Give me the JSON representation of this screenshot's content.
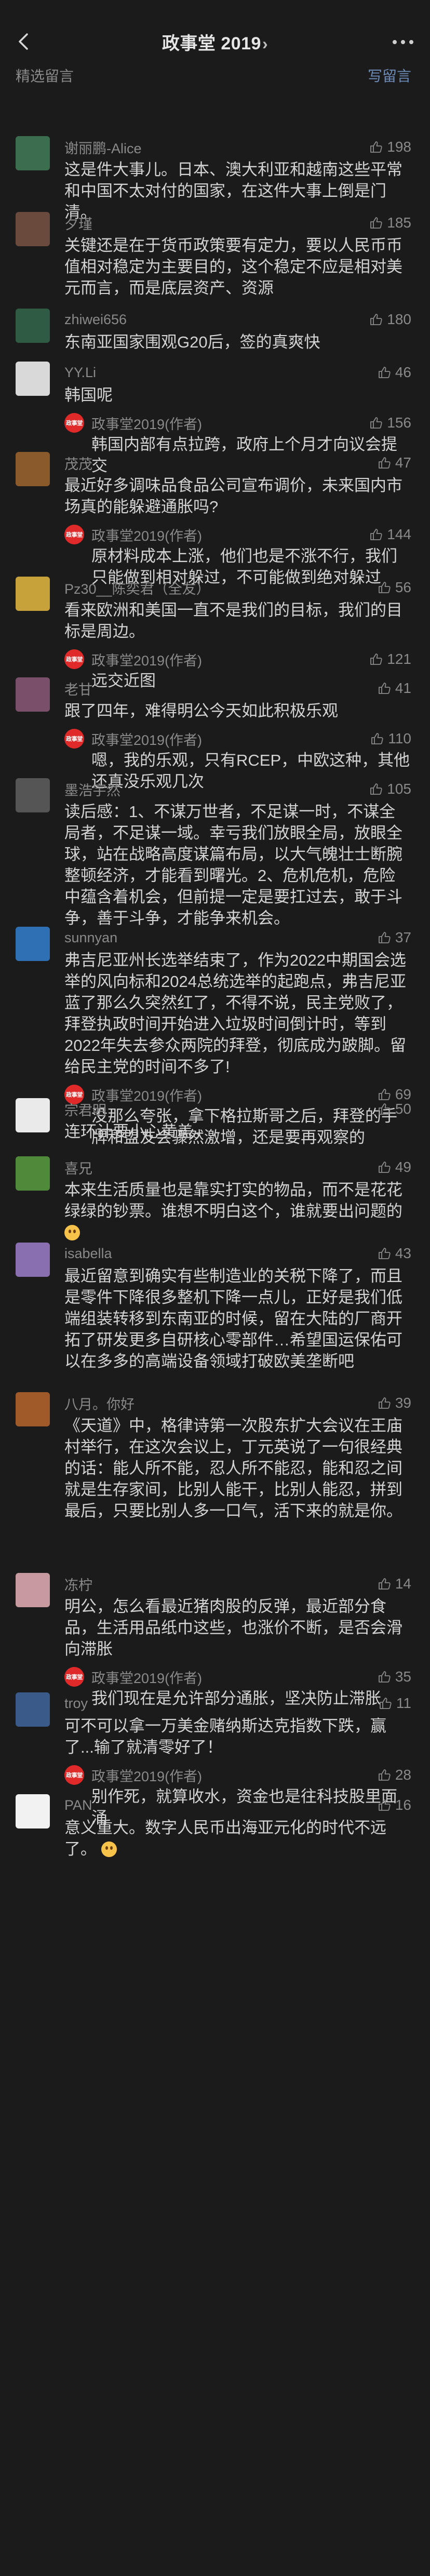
{
  "nav": {
    "title": "政事堂 2019",
    "chevron": "›"
  },
  "section": {
    "title": "精选留言",
    "action": "写留言"
  },
  "author_reply_name": "政事堂2019(作者)",
  "author_avatar_text": "政事堂",
  "comments": [
    {
      "name": "谢丽鹏-Alice",
      "likes": "198",
      "avatar": "#3b6d4f",
      "text": "这是件大事儿。日本、澳大利亚和越南这些平常和中国不太对付的国家，在这件大事上倒是门清。"
    },
    {
      "name": "夕瑾",
      "likes": "185",
      "avatar": "#6a4a3c",
      "text": "关键还是在于货币政策要有定力，要以人民币币值相对稳定为主要目的，这个稳定不应是相对美元而言，而是底层资产、资源"
    },
    {
      "name": "zhiwei656",
      "likes": "180",
      "avatar": "#2f5a44",
      "text": "东南亚国家围观G20后，签的真爽快"
    },
    {
      "name": "YY.Li",
      "likes": "46",
      "avatar": "#d9d9d9",
      "text": "韩国呢",
      "reply": {
        "likes": "156",
        "text": "韩国内部有点拉跨，政府上个月才向议会提交"
      }
    },
    {
      "name": "茂茂",
      "likes": "47",
      "avatar": "#8a5a2b",
      "text": "最近好多调味品食品公司宣布调价，未来国内市场真的能躲避通胀吗?",
      "reply": {
        "likes": "144",
        "text": "原材料成本上涨，他们也是不涨不行，我们只能做到相对躲过，不可能做到绝对躲过"
      }
    },
    {
      "name": "Pz30__陈奕君（全友）",
      "likes": "56",
      "avatar": "#c7a23a",
      "text": "看来欧洲和美国一直不是我们的目标，我们的目标是周边。",
      "reply": {
        "likes": "121",
        "text": "远交近图"
      }
    },
    {
      "name": "老甘",
      "likes": "41",
      "avatar": "#7a4f6a",
      "text": "跟了四年，难得明公今天如此积极乐观",
      "reply": {
        "likes": "110",
        "text": "嗯，我的乐观，只有RCEP，中欧这种，其他还真没乐观几次"
      }
    },
    {
      "name": "墨浩宇然",
      "likes": "105",
      "avatar": "#555555",
      "text": "读后感：1、不谋万世者，不足谋一时，不谋全局者，不足谋一域。幸亏我们放眼全局，放眼全球，站在战略高度谋篇布局，以大气魄壮士断腕整顿经济，才能看到曙光。2、危机危机，危险中蕴含着机会，但前提一定是要扛过去，敢于斗争，善于斗争，才能争来机会。"
    },
    {
      "name": "sunnyan",
      "likes": "37",
      "avatar": "#2f6fb3",
      "text": "弗吉尼亚州长选举结束了，作为2022中期国会选举的风向标和2024总统选举的起跑点，弗吉尼亚蓝了那么久突然红了，不得不说，民主党败了，拜登执政时间开始进入垃圾时间倒计时，等到2022年失去参众两院的拜登，彻底成为跛脚。留给民主党的时间不多了!",
      "reply": {
        "likes": "69",
        "text": "没那么夸张，拿下格拉斯哥之后，拜登的手牌和盟友会骤然激增，还是要再观察的"
      }
    },
    {
      "name": "宗君明",
      "likes": "50",
      "avatar": "#eaeaea",
      "text": "连环计要小心黄盖。"
    },
    {
      "name": "喜兄",
      "likes": "49",
      "avatar": "#4f8a3a",
      "text": "本来生活质量也是靠实打实的物品，而不是花花绿绿的钞票。谁想不明白这个，谁就要出问题的",
      "emoji": true
    },
    {
      "name": "isabella",
      "likes": "43",
      "avatar": "#8a6fb0",
      "text": "最近留意到确实有些制造业的关税下降了，而且是零件下降很多整机下降一点儿，正好是我们低端组装转移到东南亚的时候，留在大陆的厂商开拓了研发更多自研核心零部件…希望国运保佑可以在多多的高端设备领域打破欧美垄断吧"
    },
    {
      "name": "八月。你好",
      "likes": "39",
      "avatar": "#a05a2a",
      "text": "《天道》中，格律诗第一次股东扩大会议在王庙村举行，在这次会议上，丁元英说了一句很经典的话：能人所不能，忍人所不能忍，能和忍之间就是生存家间，比别人能干，比别人能忍，拼到最后，只要比别人多一口气，活下来的就是你。"
    },
    {
      "name": "冻柠",
      "likes": "14",
      "avatar": "#c79aa0",
      "text": "明公，怎么看最近猪肉股的反弹，最近部分食品，生活用品纸巾这些，也涨价不断，是否会滑向滞胀",
      "reply": {
        "likes": "35",
        "text": "我们现在是允许部分通胀，坚决防止滞胀"
      }
    },
    {
      "name": "troy",
      "likes": "11",
      "avatar": "#3a5a8a",
      "text": "可不可以拿一万美金赌纳斯达克指数下跌，赢了...输了就清零好了！",
      "reply": {
        "likes": "28",
        "text": "别作死，就算收水，资金也是往科技股里面涌"
      }
    },
    {
      "name": "PAN",
      "likes": "16",
      "avatar": "#f2f2f2",
      "text": "意义重大。数字人民币出海亚元化的时代不远了。",
      "emoji": true
    }
  ]
}
